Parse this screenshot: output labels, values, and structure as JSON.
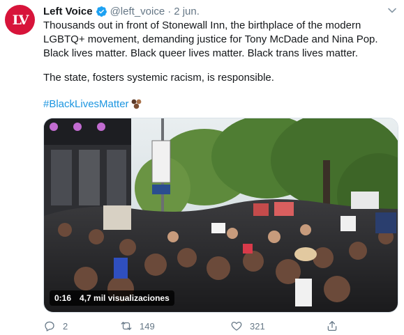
{
  "tweet": {
    "author_name": "Left Voice",
    "handle": "@left_voice",
    "separator": "·",
    "date": "2 jun.",
    "avatar_text": "LV",
    "line1": "Thousands out in front of Stonewall Inn, the birthplace of the modern",
    "line2": "LGBTQ+ movement, demanding justice for Tony McDade and Nina Pop.",
    "line3": "Black lives matter. Black queer lives matter. Black trans lives matter.",
    "paragraph2": "The state, fosters systemic racism, is responsible.",
    "hashtag": "#BlackLivesMatter",
    "emoji_icon": "raised-fists-emoji"
  },
  "media": {
    "duration": "0:16",
    "views": "4,7 mil visualizaciones"
  },
  "actions": {
    "reply_count": "2",
    "retweet_count": "149",
    "like_count": "321"
  },
  "colors": {
    "brand": "#d7143a",
    "link": "#1b95e0",
    "verified": "#1da1f2",
    "muted": "#657786"
  }
}
